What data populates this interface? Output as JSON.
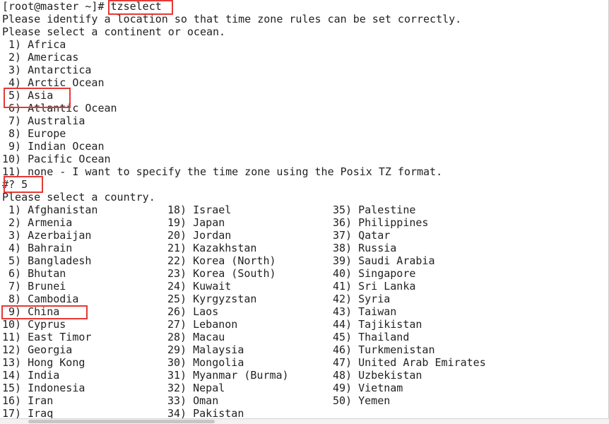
{
  "prompt_line": {
    "prompt": "[root@master ~]# ",
    "command": "tzselect"
  },
  "intro": [
    "Please identify a location so that time zone rules can be set correctly.",
    "Please select a continent or ocean."
  ],
  "continents": [
    " 1) Africa",
    " 2) Americas",
    " 3) Antarctica",
    " 4) Arctic Ocean",
    " 5) Asia",
    " 6) Atlantic Ocean",
    " 7) Australia",
    " 8) Europe",
    " 9) Indian Ocean",
    "10) Pacific Ocean",
    "11) none - I want to specify the time zone using the Posix TZ format."
  ],
  "answer_line": "#? 5",
  "country_prompt": "Please select a country.",
  "countries": {
    "col1": [
      " 1) Afghanistan",
      " 2) Armenia",
      " 3) Azerbaijan",
      " 4) Bahrain",
      " 5) Bangladesh",
      " 6) Bhutan",
      " 7) Brunei",
      " 8) Cambodia",
      " 9) China",
      "10) Cyprus",
      "11) East Timor",
      "12) Georgia",
      "13) Hong Kong",
      "14) India",
      "15) Indonesia",
      "16) Iran",
      "17) Iraq"
    ],
    "col2": [
      "18) Israel",
      "19) Japan",
      "20) Jordan",
      "21) Kazakhstan",
      "22) Korea (North)",
      "23) Korea (South)",
      "24) Kuwait",
      "25) Kyrgyzstan",
      "26) Laos",
      "27) Lebanon",
      "28) Macau",
      "29) Malaysia",
      "30) Mongolia",
      "31) Myanmar (Burma)",
      "32) Nepal",
      "33) Oman",
      "34) Pakistan"
    ],
    "col3": [
      "35) Palestine",
      "36) Philippines",
      "37) Qatar",
      "38) Russia",
      "39) Saudi Arabia",
      "40) Singapore",
      "41) Sri Lanka",
      "42) Syria",
      "43) Taiwan",
      "44) Tajikistan",
      "45) Thailand",
      "46) Turkmenistan",
      "47) United Arab Emirates",
      "48) Uzbekistan",
      "49) Vietnam",
      "50) Yemen"
    ]
  },
  "colors": {
    "text": "#222222",
    "background": "#ffffff",
    "highlight_border": "#e53935"
  }
}
